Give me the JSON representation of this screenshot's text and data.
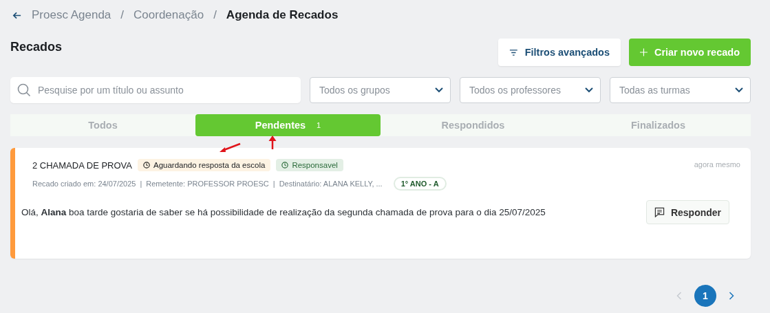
{
  "breadcrumb": [
    {
      "label": "Proesc Agenda",
      "current": false
    },
    {
      "label": "Coordenação",
      "current": false
    },
    {
      "label": "Agenda de Recados",
      "current": true
    }
  ],
  "breadcrumb_separators": [
    "/",
    "/"
  ],
  "page_title": "Recados",
  "actions": [
    {
      "label": "Filtros avançados",
      "kind": "filter"
    },
    {
      "label": "Criar novo recado",
      "kind": "create"
    }
  ],
  "search": {
    "placeholder": "Pesquise por um título ou assunto"
  },
  "selects": [
    {
      "placeholder": "Todos os grupos"
    },
    {
      "placeholder": "Todos os professores"
    },
    {
      "placeholder": "Todas as turmas"
    }
  ],
  "tabs": [
    {
      "label": "Todos",
      "selected": false
    },
    {
      "label": "Pendentes",
      "selected": true,
      "count": "1"
    },
    {
      "label": "Respondidos",
      "selected": false
    },
    {
      "label": "Finalizados",
      "selected": false
    }
  ],
  "messages": [
    {
      "title": "2 CHAMADA DE PROVA",
      "status": "Aguardando resposta da escola",
      "role": "Responsavel",
      "time": "agora mesmo",
      "meta": [
        "Recado criado em: 24/07/2025",
        "Remetente: PROFESSOR PROESC",
        "Destinatário: ALANA KELLY, ..."
      ],
      "meta_separators": [
        "|",
        "|"
      ],
      "class_tag": "1° ANO - A",
      "body": "Olá, **Alana** boa tarde gostaria de saber se há possibilidade de realização da segunda chamada de prova para o dia 25/07/2025",
      "reply_label": "Responder"
    }
  ],
  "pagination": {
    "prev_disabled": true,
    "pages": [
      {
        "label": "1",
        "selected": true
      }
    ],
    "next_disabled": false
  }
}
